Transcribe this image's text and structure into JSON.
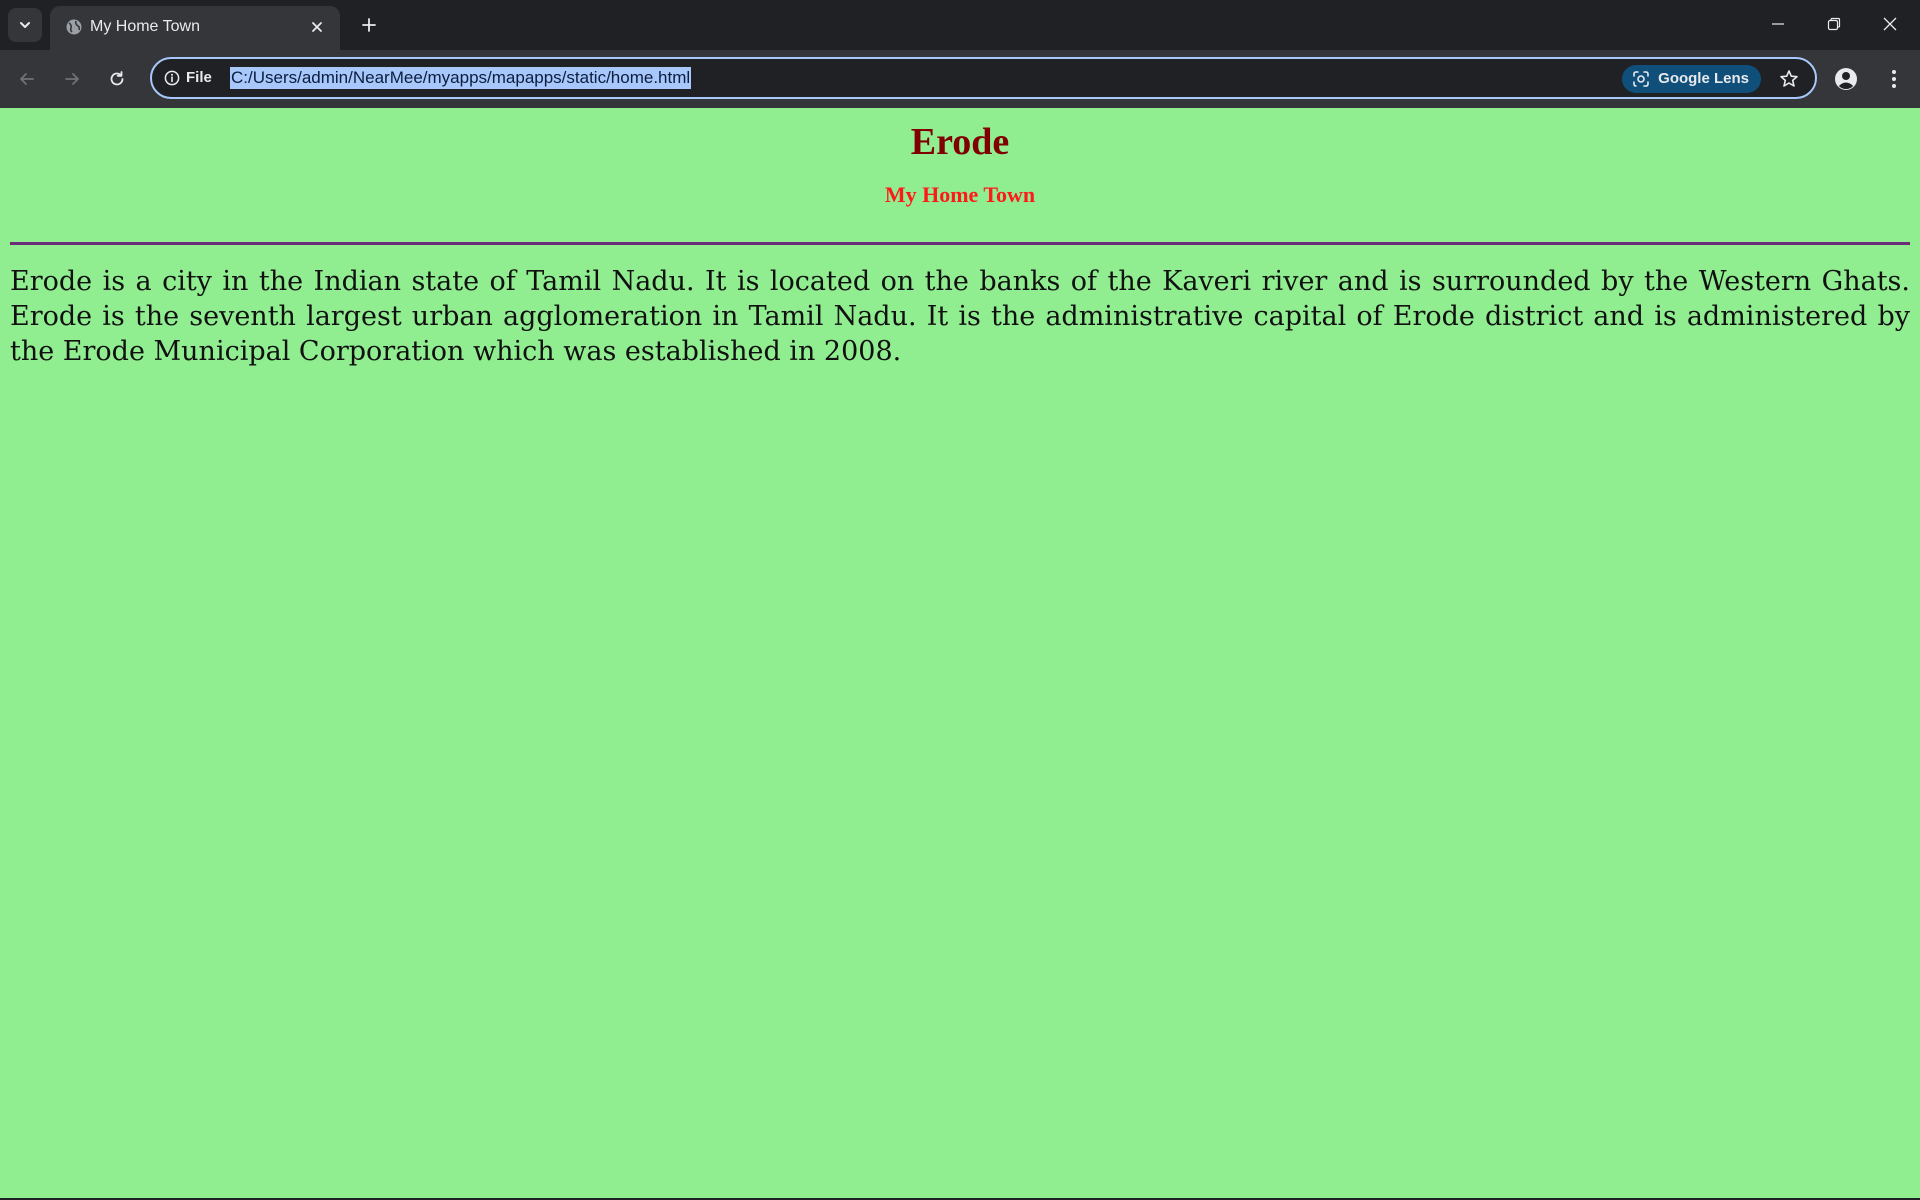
{
  "tab": {
    "title": "My Home Town",
    "favicon": "globe-icon"
  },
  "toolbar": {
    "site_info_label": "File",
    "url": "C:/Users/admin/NearMee/myapps/mapapps/static/home.html",
    "lens_label": "Google Lens"
  },
  "page": {
    "heading": "Erode",
    "subheading": "My Home Town",
    "paragraph": "Erode is a city in the Indian state of Tamil Nadu. It is located on the banks of the Kaveri river and is surrounded by the Western Ghats. Erode is the seventh largest urban agglomeration in Tamil Nadu. It is the administrative capital of Erode district and is administered by the Erode Municipal Corporation which was established in 2008."
  },
  "colors": {
    "page_background": "#90ee90",
    "heading": "#800000",
    "subheading": "#ff1a1a",
    "rule": "#6b2d7a",
    "url_highlight": "#a8c7fa"
  }
}
